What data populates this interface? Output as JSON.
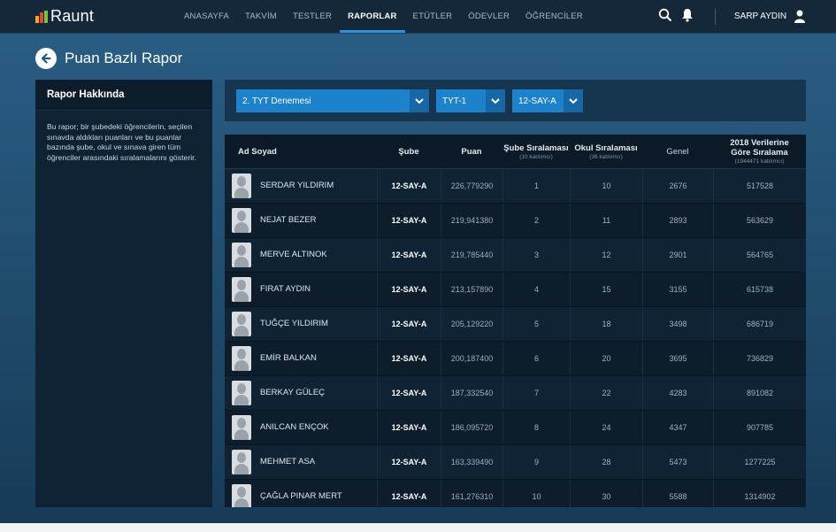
{
  "app": {
    "name": "Raunt",
    "brand_colors": [
      "#f5a623",
      "#e8462c",
      "#7cc242"
    ]
  },
  "nav": {
    "items": [
      {
        "label": "ANASAYFA",
        "active": false
      },
      {
        "label": "TAKVİM",
        "active": false
      },
      {
        "label": "TESTLER",
        "active": false
      },
      {
        "label": "RAPORLAR",
        "active": true
      },
      {
        "label": "ETÜTLER",
        "active": false
      },
      {
        "label": "ÖDEVLER",
        "active": false
      },
      {
        "label": "ÖĞRENCİLER",
        "active": false
      }
    ],
    "icons": [
      "search-icon",
      "bell-icon",
      "user-icon"
    ],
    "user_name": "SARP AYDIN"
  },
  "page": {
    "title": "Puan Bazlı Rapor",
    "back_icon": "arrow-left-icon"
  },
  "about": {
    "title": "Rapor Hakkında",
    "text": "Bu rapor; bir şubedeki öğrencilerin, seçilen sınavda aldıkları puanları ve bu puanlar bazında şube, okul ve sınava giren tüm öğrenciler arasındaki sıralamalarını gösterir."
  },
  "filters": {
    "exam": "2. TYT Denemesi",
    "type": "TYT-1",
    "class": "12-SAY-A"
  },
  "table": {
    "headers": {
      "name": "Ad Soyad",
      "sube": "Şube",
      "puan": "Puan",
      "sube_sira": "Şube Sıralaması",
      "sube_sira_sub": "(10 katılımcı)",
      "okul_sira": "Okul Sıralaması",
      "okul_sira_sub": "(36 katılımcı)",
      "genel": "Genel",
      "tr_line1": "2018 Verilerine",
      "tr_line2": "Göre Sıralama",
      "tr_sub": "(1944471 katılımcı)"
    },
    "rows": [
      {
        "name": "SERDAR YILDIRIM",
        "sube": "12-SAY-A",
        "puan": "226,779290",
        "sube_sira": "1",
        "okul_sira": "10",
        "genel": "2676",
        "tr": "517528"
      },
      {
        "name": "NEJAT BEZER",
        "sube": "12-SAY-A",
        "puan": "219,941380",
        "sube_sira": "2",
        "okul_sira": "11",
        "genel": "2893",
        "tr": "563629"
      },
      {
        "name": "MERVE ALTINOK",
        "sube": "12-SAY-A",
        "puan": "219,785440",
        "sube_sira": "3",
        "okul_sira": "12",
        "genel": "2901",
        "tr": "564765"
      },
      {
        "name": "FIRAT AYDIN",
        "sube": "12-SAY-A",
        "puan": "213,157890",
        "sube_sira": "4",
        "okul_sira": "15",
        "genel": "3155",
        "tr": "615738"
      },
      {
        "name": "TUĞÇE YILDIRIM",
        "sube": "12-SAY-A",
        "puan": "205,129220",
        "sube_sira": "5",
        "okul_sira": "18",
        "genel": "3498",
        "tr": "686719"
      },
      {
        "name": "EMİR BALKAN",
        "sube": "12-SAY-A",
        "puan": "200,187400",
        "sube_sira": "6",
        "okul_sira": "20",
        "genel": "3695",
        "tr": "736829"
      },
      {
        "name": "BERKAY GÜLEÇ",
        "sube": "12-SAY-A",
        "puan": "187,332540",
        "sube_sira": "7",
        "okul_sira": "22",
        "genel": "4283",
        "tr": "891082"
      },
      {
        "name": "ANILCAN ENÇOK",
        "sube": "12-SAY-A",
        "puan": "186,095720",
        "sube_sira": "8",
        "okul_sira": "24",
        "genel": "4347",
        "tr": "907785"
      },
      {
        "name": "MEHMET ASA",
        "sube": "12-SAY-A",
        "puan": "163,339490",
        "sube_sira": "9",
        "okul_sira": "28",
        "genel": "5473",
        "tr": "1277225"
      },
      {
        "name": "ÇAĞLA PINAR MERT",
        "sube": "12-SAY-A",
        "puan": "161,276310",
        "sube_sira": "10",
        "okul_sira": "30",
        "genel": "5588",
        "tr": "1314902"
      }
    ]
  }
}
